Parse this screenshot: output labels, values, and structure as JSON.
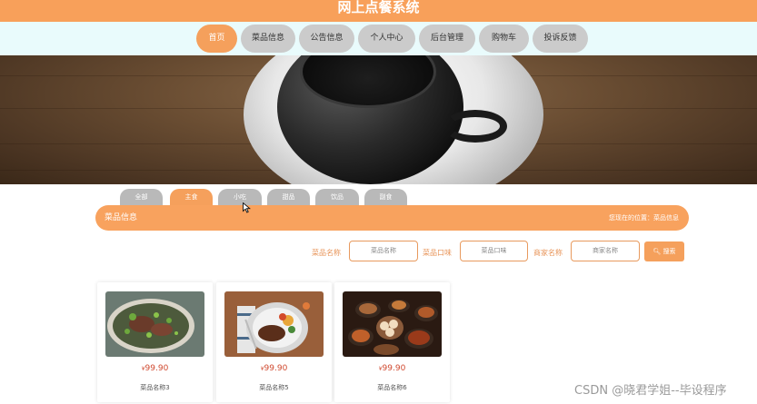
{
  "header": {
    "title": "网上点餐系统"
  },
  "nav": {
    "items": [
      {
        "label": "首页",
        "active": true
      },
      {
        "label": "菜品信息",
        "active": false
      },
      {
        "label": "公告信息",
        "active": false
      },
      {
        "label": "个人中心",
        "active": false
      },
      {
        "label": "后台管理",
        "active": false
      },
      {
        "label": "购物车",
        "active": false
      },
      {
        "label": "投诉反馈",
        "active": false
      }
    ]
  },
  "banner": {
    "slide_count": 3,
    "active_slide": 1
  },
  "categories": {
    "tabs": [
      "全部",
      "主食",
      "小吃",
      "甜品",
      "饮品",
      "副食"
    ],
    "active": "主食"
  },
  "section": {
    "title": "菜品信息",
    "breadcrumb": "您现在的位置：菜品信息"
  },
  "search": {
    "name_label": "菜品名称",
    "name_placeholder": "菜品名称",
    "taste_label": "菜品口味",
    "taste_placeholder": "菜品口味",
    "merchant_label": "商家名称",
    "merchant_placeholder": "商家名称",
    "button_label": "搜索"
  },
  "products": [
    {
      "currency": "¥",
      "price": "99.90",
      "name": "菜品名称3"
    },
    {
      "currency": "¥",
      "price": "99.90",
      "name": "菜品名称5"
    },
    {
      "currency": "¥",
      "price": "99.90",
      "name": "菜品名称6"
    }
  ],
  "watermark": "CSDN @晓君学姐--毕设程序",
  "colors": {
    "accent": "#f5a05c",
    "nav_bg": "#e9fbfc",
    "inactive": "#cbcbcb",
    "price": "#d0492f"
  }
}
